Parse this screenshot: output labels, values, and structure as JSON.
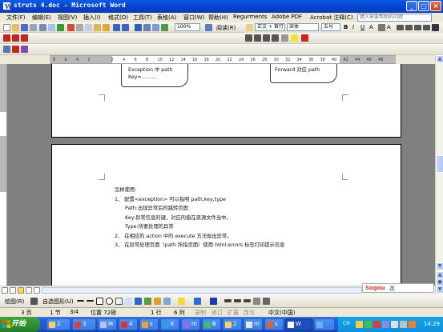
{
  "window": {
    "title": "struts 4.doc - Microsoft Word",
    "minimize_label": "_",
    "maximize_label": "□",
    "close_label": "×"
  },
  "menu": {
    "items": [
      "文件(F)",
      "编辑(E)",
      "视图(V)",
      "插入(I)",
      "格式(O)",
      "工具(T)",
      "表格(A)",
      "窗口(W)",
      "帮助(H)",
      "Regurments",
      "Adobe PDF",
      "Acrobat 注释(C)"
    ],
    "help_placeholder": "键入需要帮助的问题"
  },
  "toolbar": {
    "zoom": "100%",
    "read_label": "阅读(R)",
    "style": "正文 + 首行",
    "font": "宋体",
    "size": "五号"
  },
  "ruler": {
    "ticks": [
      "8",
      "6",
      "4",
      "2",
      "",
      "2",
      "4",
      "6",
      "8",
      "10",
      "12",
      "14",
      "16",
      "18",
      "20",
      "22",
      "24",
      "26",
      "28",
      "30",
      "32",
      "34",
      "36",
      "38",
      "40",
      "42",
      "44",
      "46",
      "48"
    ]
  },
  "document": {
    "page1_box_left": [
      "Exception 中 path",
      "Key=………"
    ],
    "page1_box_right": "Forward 对应 path",
    "page2_lines": [
      "怎样使用:",
      "1、  配置<exception> 可以指明 path,key,type",
      "Path:出现异常后的跳转页面",
      "Key:异常信息的键，对应的值在资源文件当中。",
      "Type:所要处理的异常",
      "2、  在相应的 action 中的 execute 方法抛出异常。",
      "3、  在异常处理页面（path 所指页面）使用 html:errors 标签打印提示信息"
    ]
  },
  "drawbar": {
    "draw_label": "绘图(R)",
    "autoshape_label": "自选图形(U)"
  },
  "status": {
    "page": "3 页",
    "section": "1 节",
    "page_of": "3/4",
    "position": "位置 72磅",
    "line": "1 行",
    "column": "6 列",
    "rec": "录制",
    "trk": "修订",
    "ext": "扩展",
    "ovr": "改写",
    "language": "中文(中国)"
  },
  "taskbar": {
    "start_label": "开始",
    "tasks": [
      "2",
      "3",
      "M",
      "4",
      "s",
      "E",
      "m",
      "B",
      "2",
      "m",
      "s",
      "W"
    ],
    "tray_lang": "CH",
    "clock": "14:29"
  },
  "ime": {
    "brand": "Sogou",
    "mode": "英"
  },
  "colors": {
    "titlebar": "#0a4fd6",
    "taskbar": "#245edb",
    "start": "#2e8f2e",
    "tray": "#0e8ee0"
  }
}
